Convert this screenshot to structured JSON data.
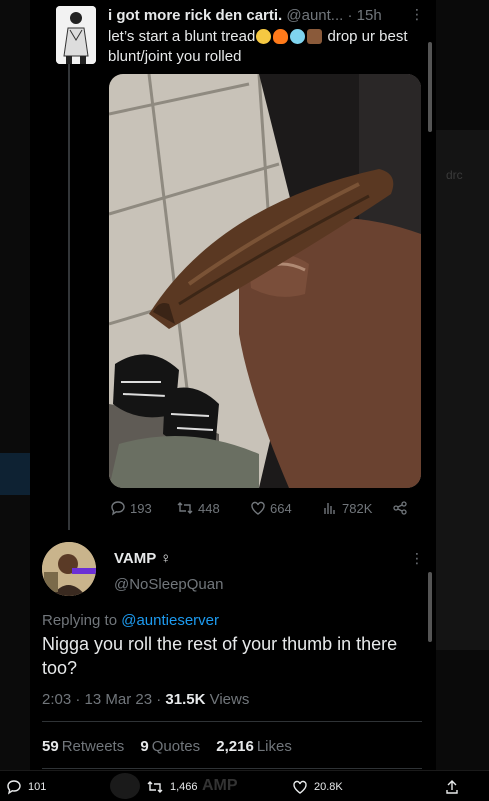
{
  "quoted_tweet": {
    "display_name": "i got more rick den carti.",
    "handle": "@aunt...",
    "time": "· 15h",
    "text_part1": "let’s start a blunt tread",
    "text_part2": "drop ur best blunt/joint you rolled",
    "stats": {
      "replies": "193",
      "retweets": "448",
      "likes": "664",
      "views": "782K"
    }
  },
  "reply": {
    "display_name": "VAMP",
    "name_symbol": "♀",
    "handle": "@NoSleepQuan",
    "replying_label": "Replying to ",
    "replying_to": "@auntieserver",
    "text": "Nigga you roll the rest of your thumb in there too?",
    "time": "2:03 · 13 Mar 23 · ",
    "views_count": "31.5K",
    "views_label": "Views",
    "retweets_count": "59",
    "retweets_label": "Retweets",
    "quotes_count": "9",
    "quotes_label": "Quotes",
    "likes_count": "2,216",
    "likes_label": "Likes"
  },
  "bottom_bar": {
    "replies": "101",
    "retweets": "1,466",
    "likes": "20.8K"
  },
  "background": {
    "ghost_right": "drc",
    "ghost_bottom": "AMP"
  }
}
